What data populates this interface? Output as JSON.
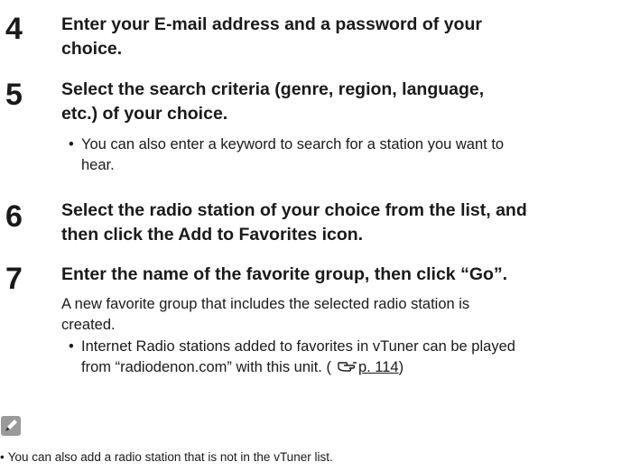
{
  "steps": [
    {
      "number": "4",
      "heading_line1": "Enter your E-mail address and a password of your",
      "heading_line2": "choice."
    },
    {
      "number": "5",
      "heading_line1": "Select the search criteria (genre, region, language,",
      "heading_line2": "etc.) of your choice.",
      "bullet_line1": "You can also enter a keyword to search for a station you want to",
      "bullet_line2": "hear."
    },
    {
      "number": "6",
      "heading_line1": "Select the radio station of your choice from the list, and",
      "heading_line2": "then click the Add to Favorites icon."
    },
    {
      "number": "7",
      "heading_line1": "Enter the name of the favorite group, then click “Go”.",
      "para_line1": "A new favorite group that includes the selected radio station is",
      "para_line2": "created.",
      "bullet_line1": "Internet Radio stations added to favorites in vTuner can be played",
      "bullet_line2_prefix": "from “radiodenon.com” with this unit.  (",
      "bullet_link": "p. 114",
      "bullet_line2_suffix": ")"
    }
  ],
  "bullet_char": "•",
  "note": {
    "icon": "pencil-icon",
    "text": "You can also add a radio station that is not in the vTuner list."
  }
}
